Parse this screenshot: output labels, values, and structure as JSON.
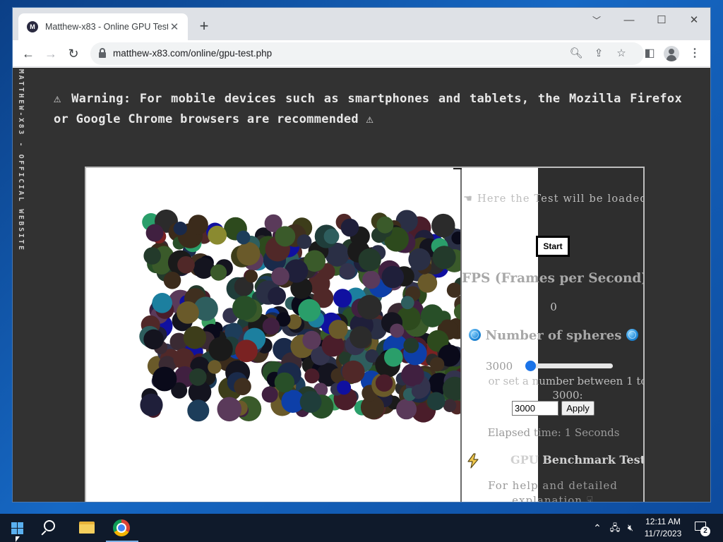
{
  "browser": {
    "tab": {
      "title": "Matthew-x83 - Online GPU Test",
      "favicon_icon": "matthew-x83-logo"
    },
    "new_tab_label": "+",
    "window_controls": {
      "collapse": "﹀",
      "minimize": "—",
      "maximize": "☐",
      "close": "✕"
    },
    "url": "matthew-x83.com/online/gpu-test.php"
  },
  "page": {
    "side_brand": "MATTHEW-X83 - OFFICIAL WEBSITE",
    "warning": "⚠ Warning: For mobile devices such as smartphones and tablets, the Mozilla Firefox or Google Chrome browsers are recommended ⚠",
    "panel": {
      "loaded_note": "☚ Here the Test will be loaded",
      "start_label": "Start",
      "fps_title": "FPS (Frames per Second)",
      "fps_value": "0",
      "spheres_title": "Number of spheres",
      "sphere_count": "3000",
      "slider_fraction": 0.0,
      "set_number_text": "or set a number between 1 to 3000:",
      "input_value": "3000",
      "apply_label": "Apply",
      "elapsed": "Elapsed time: 1 Seconds",
      "bench_title": "GPU Benchmark Test",
      "help_text": "For help and detailed explanation ☟"
    },
    "colors": {
      "page_bg": "#323232",
      "accent": "#1a73e8"
    }
  },
  "taskbar": {
    "time": "12:11 AM",
    "date": "11/7/2023",
    "notification_count": "2"
  }
}
